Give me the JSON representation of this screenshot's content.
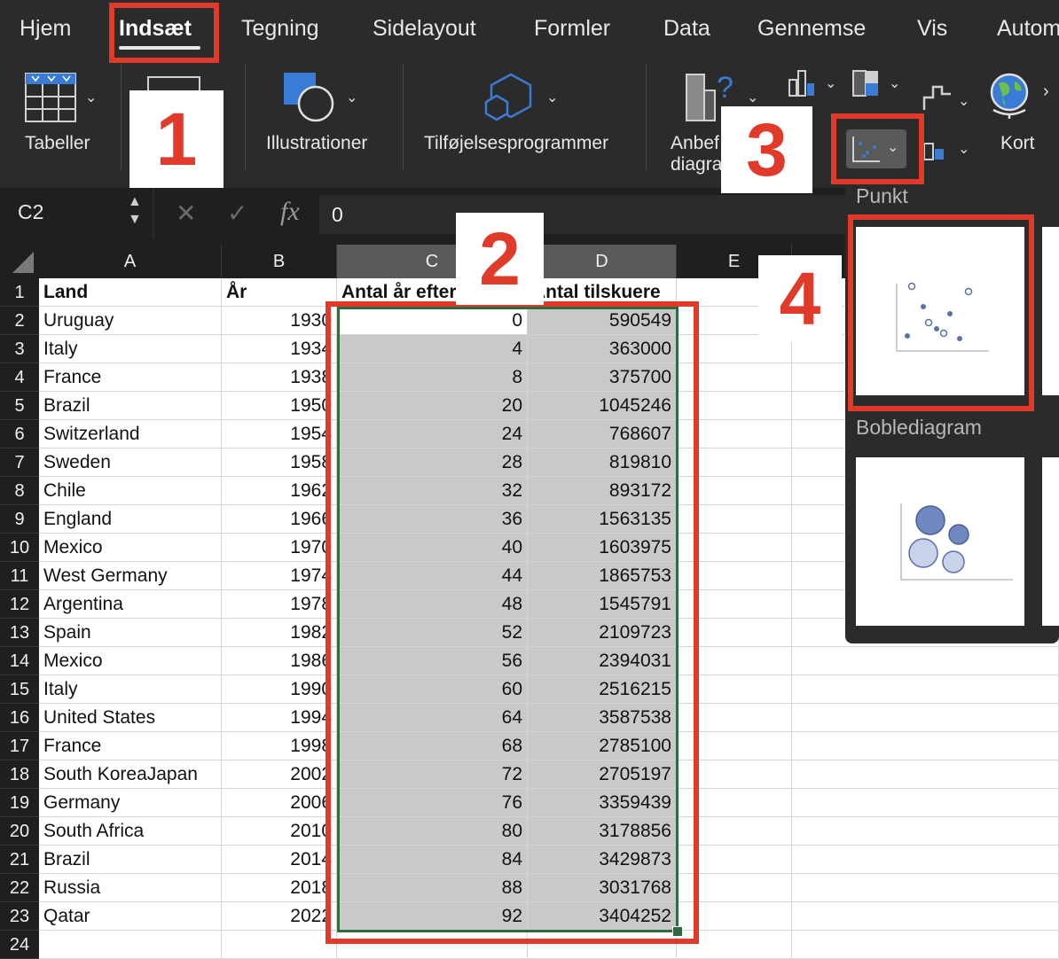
{
  "ribbon": {
    "tabs": [
      "Hjem",
      "Indsæt",
      "Tegning",
      "Sidelayout",
      "Formler",
      "Data",
      "Gennemse",
      "Vis",
      "Autom"
    ],
    "active_tab": "Indsæt",
    "groups": {
      "tables": "Tabeller",
      "illustrations": "Illustrationer",
      "addins": "Tilføjelsesprogrammer",
      "recommended_1": "Anbef",
      "recommended_2": "diagra",
      "maps": "Kort"
    }
  },
  "formula_bar": {
    "name_box": "C2",
    "fx": "fx",
    "value": "0"
  },
  "annotations": {
    "step1": "1",
    "step2": "2",
    "step3": "3",
    "step4": "4"
  },
  "columns": [
    "A",
    "B",
    "C",
    "D",
    "E"
  ],
  "headers": {
    "a": "Land",
    "b": "År",
    "c": "Antal år efter 1930",
    "d": "Antal tilskuere"
  },
  "rows": [
    {
      "n": "2",
      "land": "Uruguay",
      "year": "1930",
      "c": "0",
      "d": "590549"
    },
    {
      "n": "3",
      "land": "Italy",
      "year": "1934",
      "c": "4",
      "d": "363000"
    },
    {
      "n": "4",
      "land": "France",
      "year": "1938",
      "c": "8",
      "d": "375700"
    },
    {
      "n": "5",
      "land": "Brazil",
      "year": "1950",
      "c": "20",
      "d": "1045246"
    },
    {
      "n": "6",
      "land": "Switzerland",
      "year": "1954",
      "c": "24",
      "d": "768607"
    },
    {
      "n": "7",
      "land": "Sweden",
      "year": "1958",
      "c": "28",
      "d": "819810"
    },
    {
      "n": "8",
      "land": "Chile",
      "year": "1962",
      "c": "32",
      "d": "893172"
    },
    {
      "n": "9",
      "land": "England",
      "year": "1966",
      "c": "36",
      "d": "1563135"
    },
    {
      "n": "10",
      "land": "Mexico",
      "year": "1970",
      "c": "40",
      "d": "1603975"
    },
    {
      "n": "11",
      "land": "West Germany",
      "year": "1974",
      "c": "44",
      "d": "1865753"
    },
    {
      "n": "12",
      "land": "Argentina",
      "year": "1978",
      "c": "48",
      "d": "1545791"
    },
    {
      "n": "13",
      "land": "Spain",
      "year": "1982",
      "c": "52",
      "d": "2109723"
    },
    {
      "n": "14",
      "land": "Mexico",
      "year": "1986",
      "c": "56",
      "d": "2394031"
    },
    {
      "n": "15",
      "land": "Italy",
      "year": "1990",
      "c": "60",
      "d": "2516215"
    },
    {
      "n": "16",
      "land": "United States",
      "year": "1994",
      "c": "64",
      "d": "3587538"
    },
    {
      "n": "17",
      "land": "France",
      "year": "1998",
      "c": "68",
      "d": "2785100"
    },
    {
      "n": "18",
      "land": "South KoreaJapan",
      "year": "2002",
      "c": "72",
      "d": "2705197"
    },
    {
      "n": "19",
      "land": "Germany",
      "year": "2006",
      "c": "76",
      "d": "3359439"
    },
    {
      "n": "20",
      "land": "South Africa",
      "year": "2010",
      "c": "80",
      "d": "3178856"
    },
    {
      "n": "21",
      "land": "Brazil",
      "year": "2014",
      "c": "84",
      "d": "3429873"
    },
    {
      "n": "22",
      "land": "Russia",
      "year": "2018",
      "c": "88",
      "d": "3031768"
    },
    {
      "n": "23",
      "land": "Qatar",
      "year": "2022",
      "c": "92",
      "d": "3404252"
    }
  ],
  "first_row_number": "1",
  "last_row_number": "24",
  "dropdown": {
    "scatter_label": "Punkt",
    "bubble_label": "Boblediagram"
  },
  "colors": {
    "accent_red": "#e03a2b",
    "selection_green": "#2f6b3f",
    "ribbon_bg": "#2b2b2b",
    "chart_blue": "#5b6fa8"
  }
}
